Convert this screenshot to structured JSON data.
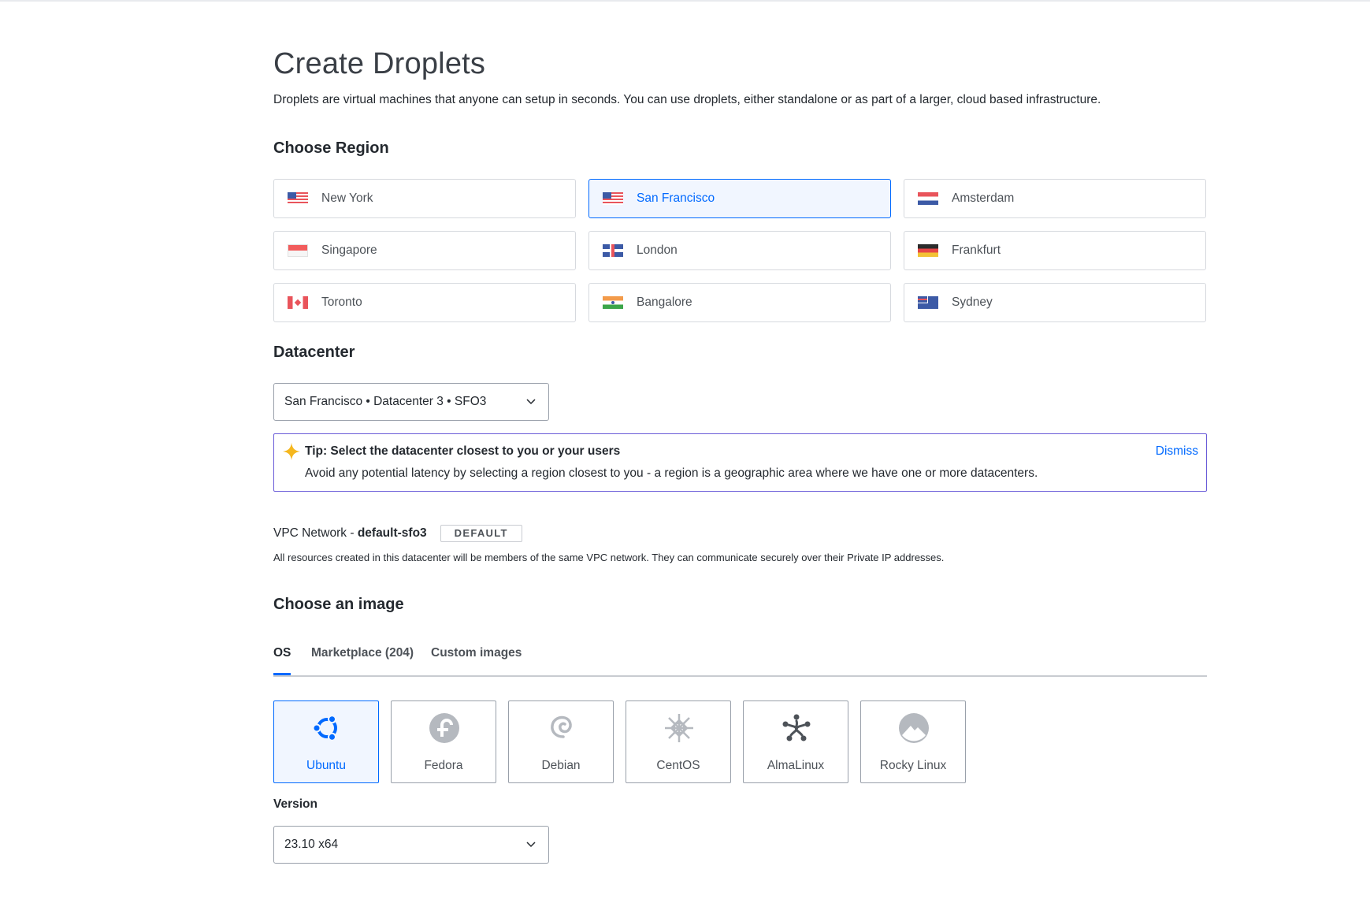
{
  "page": {
    "title": "Create Droplets",
    "subtitle": "Droplets are virtual machines that anyone can setup in seconds. You can use droplets, either standalone or as part of a larger, cloud based infrastructure."
  },
  "region": {
    "heading": "Choose Region",
    "selected": "San Francisco",
    "items": [
      {
        "label": "New York",
        "flag": "us-flag-icon"
      },
      {
        "label": "San Francisco",
        "flag": "us-flag-icon"
      },
      {
        "label": "Amsterdam",
        "flag": "nl-flag-icon"
      },
      {
        "label": "Singapore",
        "flag": "sg-flag-icon"
      },
      {
        "label": "London",
        "flag": "uk-flag-icon"
      },
      {
        "label": "Frankfurt",
        "flag": "de-flag-icon"
      },
      {
        "label": "Toronto",
        "flag": "ca-flag-icon"
      },
      {
        "label": "Bangalore",
        "flag": "in-flag-icon"
      },
      {
        "label": "Sydney",
        "flag": "au-flag-icon"
      }
    ]
  },
  "datacenter": {
    "heading": "Datacenter",
    "value": "San Francisco • Datacenter 3 • SFO3"
  },
  "tip": {
    "icon": "sparkle-star-icon",
    "title": "Tip: Select the datacenter closest to you or your users",
    "body": "Avoid any potential latency by selecting a region closest to you - a region is a geographic area where we have one or more datacenters.",
    "dismiss": "Dismiss"
  },
  "vpc": {
    "prefix": "VPC Network - ",
    "name": "default-sfo3",
    "badge": "DEFAULT",
    "description": "All resources created in this datacenter will be members of the same VPC network. They can communicate securely over their Private IP addresses."
  },
  "image": {
    "heading": "Choose an image",
    "tabs": [
      {
        "label": "OS",
        "active": true
      },
      {
        "label": "Marketplace (204)",
        "active": false
      },
      {
        "label": "Custom images",
        "active": false
      }
    ],
    "selected": "Ubuntu",
    "os": [
      {
        "label": "Ubuntu",
        "icon": "ubuntu-icon"
      },
      {
        "label": "Fedora",
        "icon": "fedora-icon"
      },
      {
        "label": "Debian",
        "icon": "debian-icon"
      },
      {
        "label": "CentOS",
        "icon": "centos-icon"
      },
      {
        "label": "AlmaLinux",
        "icon": "almalinux-icon"
      },
      {
        "label": "Rocky Linux",
        "icon": "rocky-linux-icon"
      }
    ]
  },
  "version": {
    "label": "Version",
    "value": "23.10 x64"
  },
  "colors": {
    "accent": "#0069ff",
    "selected_bg": "#f1f6ff",
    "tip_border": "#6a5cd8",
    "tip_star": "#f5b71e"
  }
}
